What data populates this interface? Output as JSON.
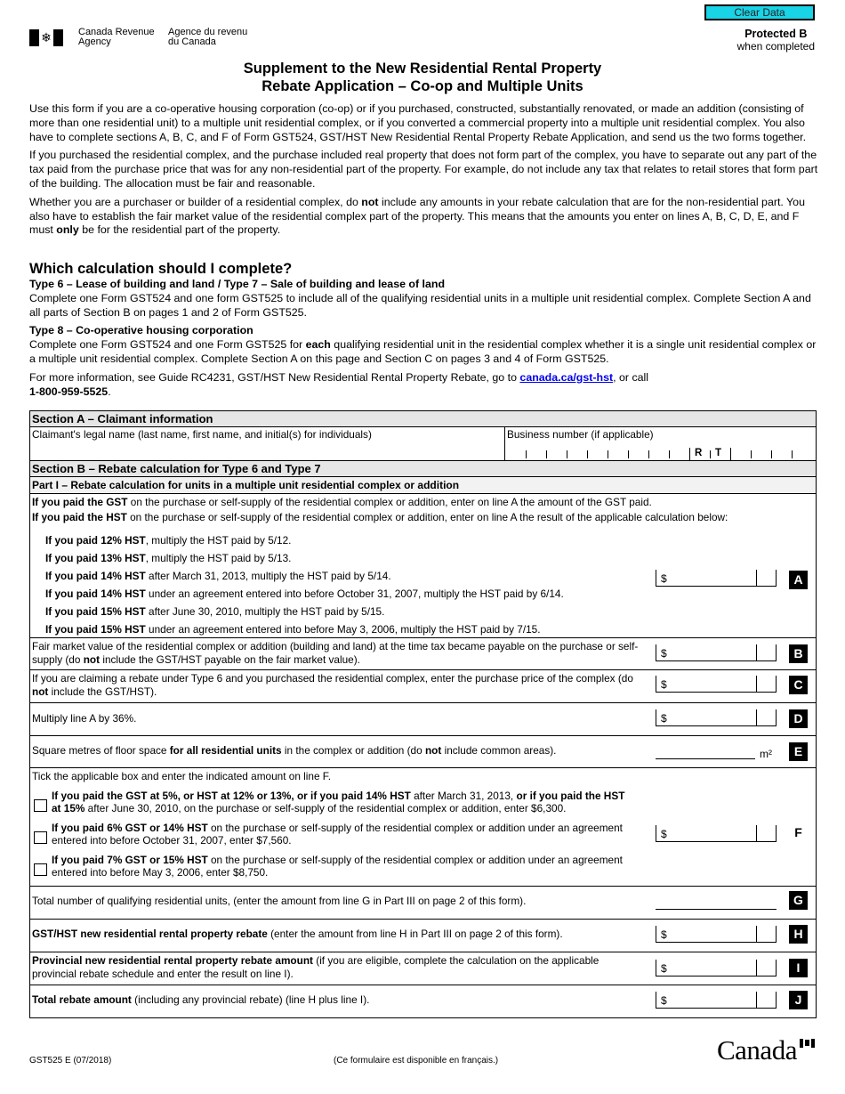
{
  "header": {
    "clear_button": "Clear Data",
    "protected": "Protected B",
    "protected_note": "when completed",
    "agency_en_1": "Canada Revenue",
    "agency_en_2": "Agency",
    "agency_fr_1": "Agence du revenu",
    "agency_fr_2": "du Canada",
    "title_line1": "Supplement to the New Residential Rental Property",
    "title_line2": "Rebate Application – Co-op and Multiple Units"
  },
  "intro": {
    "p1": "Use this form if you are a co-operative housing corporation (co-op) or if you purchased, constructed, substantially renovated, or made an addition (consisting of more than one residential unit) to a multiple unit residential complex, or if you converted a commercial property into a multiple unit residential complex. You also have to complete sections A, B, C, and F of Form GST524, GST/HST New Residential Rental Property Rebate Application, and send us the two forms together.",
    "p2": "If you purchased the residential complex, and the purchase included real property that does not form part of the complex, you have to separate out any part of the tax paid from the purchase price that was for any non-residential part of the property. For example, do not include any tax that relates to retail stores that form part of the building. The allocation must be fair and reasonable.",
    "p3_a": "Whether you are a purchaser or builder of a residential complex, do ",
    "p3_b": "not",
    "p3_c": " include any amounts in your rebate calculation that are for the non-residential part. You also have to establish the fair market value of the residential complex part of the property. This means that the amounts you enter on lines A, B, C, D, E, and F must ",
    "p3_d": "only",
    "p3_e": " be for the residential part of the property."
  },
  "which": {
    "heading": "Which calculation should I complete?",
    "type67_heading": "Type 6 – Lease of building and land / Type 7 – Sale of building and lease of land",
    "type67_text": "Complete one Form GST524 and one form GST525 to include all of the qualifying residential units in a multiple unit residential complex. Complete Section A and all parts of Section B on pages 1 and 2 of Form GST525.",
    "type8_heading": "Type 8 – Co-operative housing corporation",
    "type8_a": "Complete one Form GST524 and one Form GST525 for ",
    "type8_b": "each",
    "type8_c": " qualifying residential unit in the residential complex whether it is a single unit residential complex or a multiple unit residential complex. Complete Section A on this page and Section C on pages 3 and 4 of Form GST525.",
    "more_a": "For more information, see Guide RC4231, GST/HST New Residential Rental Property Rebate, go to ",
    "more_link": "canada.ca/gst-hst",
    "more_b": ", or call",
    "phone": "1-800-959-5525",
    "more_c": "."
  },
  "section_a": {
    "header": "Section A – Claimant information",
    "name_label": "Claimant's legal name (last name, first name, and initial(s) for individuals)",
    "name_value": "",
    "bn_label": "Business number (if applicable)",
    "bn_r": "R",
    "bn_t": "T",
    "bn_value": ""
  },
  "section_b": {
    "header": "Section B – Rebate calculation for Type 6 and Type 7",
    "part1_header": "Part I – Rebate calculation for units in a multiple unit residential complex or addition",
    "gst_a": "If you paid the GST",
    "gst_b": " on the purchase or self-supply of the residential complex or addition, enter on line A the amount of the GST paid.",
    "hst_a": "If you paid the HST",
    "hst_b": " on the purchase or self-supply of the residential complex or addition, enter on line A the result of the applicable calculation below:",
    "hst_items": [
      {
        "bold": "If you paid 12% HST",
        "text": ", multiply the HST paid by 5/12."
      },
      {
        "bold": "If you paid 13% HST",
        "text": ", multiply the HST paid by 5/13."
      },
      {
        "bold": "If you paid 14% HST",
        "text": " after March 31, 2013, multiply the HST paid by 5/14."
      },
      {
        "bold": "If you paid 14% HST",
        "text": " under an agreement entered into before October 31, 2007, multiply the HST paid by 6/14."
      },
      {
        "bold": "If you paid 15% HST",
        "text": " after June 30, 2010, multiply the HST paid by 5/15."
      },
      {
        "bold": "If you paid 15% HST",
        "text": " under an agreement entered into before May 3, 2006, multiply the HST paid by 7/15."
      }
    ],
    "currency": "$",
    "lines": {
      "A": {
        "letter": "A",
        "value": ""
      },
      "B": {
        "letter": "B",
        "text_a": "Fair market value of the residential complex or addition (building and land) at the time tax became payable on the purchase or self-supply (do ",
        "text_b": "not",
        "text_c": " include the GST/HST payable on the fair market value).",
        "value": ""
      },
      "C": {
        "letter": "C",
        "text_a": "If you are claiming a rebate under Type 6 and you purchased the residential complex, enter the purchase price of the complex (do ",
        "text_b": "not",
        "text_c": " include the GST/HST).",
        "value": ""
      },
      "D": {
        "letter": "D",
        "text": "Multiply line A by 36%.",
        "value": ""
      },
      "E": {
        "letter": "E",
        "text_a": "Square metres of floor space ",
        "text_b": "for all residential units",
        "text_c": " in the complex or addition (do ",
        "text_d": "not",
        "text_e": " include common areas).",
        "unit": "m²",
        "value": ""
      },
      "F": {
        "letter": "F",
        "intro": "Tick the applicable box and enter the indicated amount on line F.",
        "options": [
          {
            "bold1": "If you paid the GST at 5%, or HST at 12% or 13%, or if you paid 14% HST",
            "text1": " after March 31, 2013, ",
            "bold2": "or if you paid the HST at 15%",
            "text2": " after June 30, 2010, on the purchase or self-supply of the residential complex or addition, enter $6,300.",
            "checked": false
          },
          {
            "bold1": "If you paid 6% GST or 14% HST",
            "text1": " on the purchase or self-supply of the residential complex or addition under an agreement entered into before October 31, 2007, enter $7,560.",
            "bold2": "",
            "text2": "",
            "checked": false
          },
          {
            "bold1": "If you paid 7% GST or 15% HST",
            "text1": " on the purchase or self-supply of the residential complex or addition under an agreement entered into before May 3, 2006, enter $8,750.",
            "bold2": "",
            "text2": "",
            "checked": false
          }
        ],
        "value": ""
      },
      "G": {
        "letter": "G",
        "text": "Total number of qualifying residential units, (enter the amount from line G in Part III on page 2 of this form).",
        "value": ""
      },
      "H": {
        "letter": "H",
        "bold": "GST/HST new residential rental property rebate",
        "text": " (enter the amount from line H in Part III on page 2 of this form).",
        "value": ""
      },
      "I": {
        "letter": "I",
        "bold": "Provincial new residential rental property rebate amount",
        "text": " (if you are eligible, complete the calculation on the applicable provincial rebate schedule and enter the result on line I).",
        "value": ""
      },
      "J": {
        "letter": "J",
        "bold": "Total rebate amount",
        "text": " (including any provincial rebate) (line H plus line I).",
        "value": ""
      }
    }
  },
  "footer": {
    "form_code": "GST525 E (07/2018)",
    "french_note": "(Ce formulaire est disponible en français.)",
    "wordmark": "Canada"
  }
}
